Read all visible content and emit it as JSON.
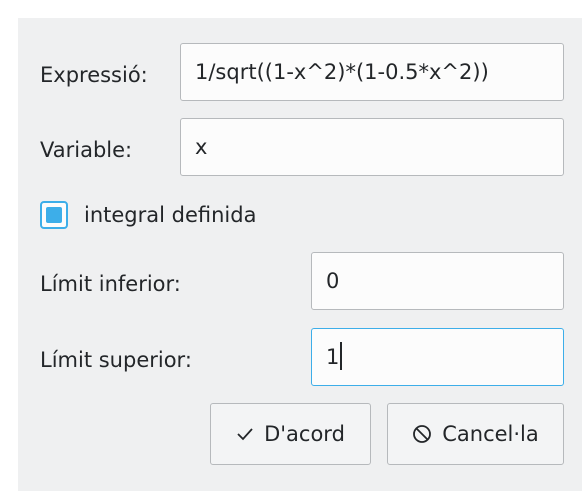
{
  "form": {
    "expression_label": "Expressió:",
    "expression_value": "1/sqrt((1-x^2)*(1-0.5*x^2))",
    "variable_label": "Variable:",
    "variable_value": "x",
    "definite_checkbox_label": "integral definida",
    "definite_checked": true,
    "lower_limit_label": "Límit inferior:",
    "lower_limit_value": "0",
    "upper_limit_label": "Límit superior:",
    "upper_limit_value": "1"
  },
  "buttons": {
    "ok_label": "D'acord",
    "ok_icon": "checkmark-icon",
    "cancel_label": "Cancel·la",
    "cancel_icon": "cancel-icon"
  },
  "colors": {
    "accent": "#3daee9",
    "window_bg": "#eff0f1",
    "text": "#232629"
  }
}
